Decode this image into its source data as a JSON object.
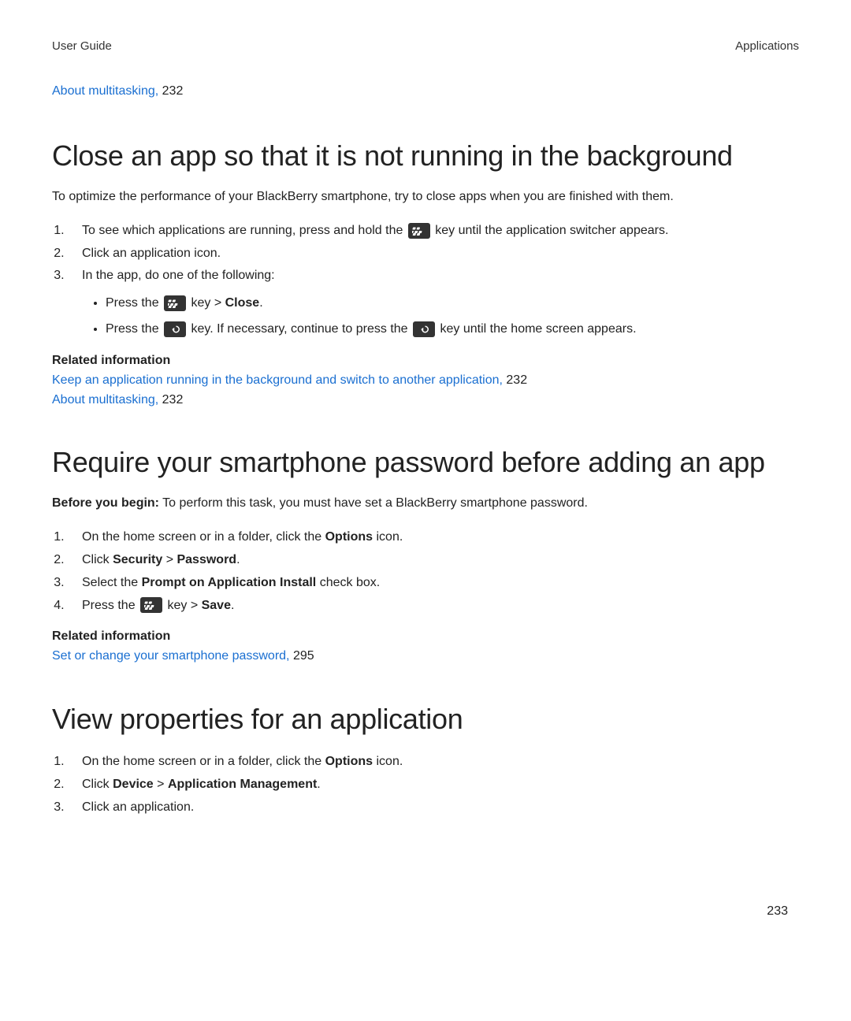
{
  "header": {
    "left": "User Guide",
    "right": "Applications"
  },
  "topRef": {
    "link": "About multitasking,",
    "page": "232"
  },
  "section1": {
    "heading": "Close an app so that it is not running in the background",
    "intro": "To optimize the performance of your BlackBerry smartphone, try to close apps when you are finished with them.",
    "steps": {
      "s1a": "To see which applications are running, press and hold the ",
      "s1b": " key until the application switcher appears.",
      "s2": "Click an application icon.",
      "s3": "In the app, do one of the following:",
      "bullet1a": "Press the ",
      "bullet1b": " key > ",
      "bullet1c": "Close",
      "bullet1d": ".",
      "bullet2a": "Press the ",
      "bullet2b": " key. If necessary, continue to press the ",
      "bullet2c": " key until the home screen appears."
    },
    "relatedHeading": "Related information",
    "relatedLinks": [
      {
        "text": "Keep an application running in the background and switch to another application,",
        "page": "232"
      },
      {
        "text": "About multitasking,",
        "page": "232"
      }
    ]
  },
  "section2": {
    "heading": "Require your smartphone password before adding an app",
    "beforeLabel": "Before you begin:",
    "beforeText": " To perform this task, you must have set a BlackBerry smartphone password.",
    "steps": {
      "s1a": "On the home screen or in a folder, click the ",
      "s1b": "Options",
      "s1c": " icon.",
      "s2a": "Click ",
      "s2b": "Security",
      "s2c": " > ",
      "s2d": "Password",
      "s2e": ".",
      "s3a": "Select the ",
      "s3b": "Prompt on Application Install",
      "s3c": " check box.",
      "s4a": "Press the ",
      "s4b": " key > ",
      "s4c": "Save",
      "s4d": "."
    },
    "relatedHeading": "Related information",
    "relatedLinks": [
      {
        "text": "Set or change your smartphone password,",
        "page": "295"
      }
    ]
  },
  "section3": {
    "heading": "View properties for an application",
    "steps": {
      "s1a": "On the home screen or in a folder, click the ",
      "s1b": "Options",
      "s1c": " icon.",
      "s2a": "Click ",
      "s2b": "Device",
      "s2c": " > ",
      "s2d": "Application Management",
      "s2e": ".",
      "s3": "Click an application."
    }
  },
  "pageNumber": "233"
}
